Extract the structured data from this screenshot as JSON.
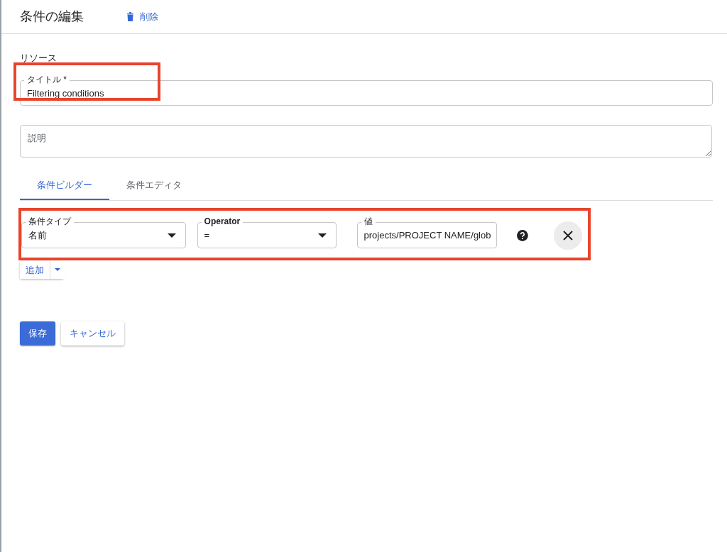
{
  "header": {
    "title": "条件の編集",
    "delete_label": "削除"
  },
  "section_label": "リソース",
  "title_field": {
    "label": "タイトル *",
    "value": "Filtering conditions"
  },
  "description_field": {
    "placeholder": "説明"
  },
  "tabs": [
    {
      "label": "条件ビルダー",
      "selected": true
    },
    {
      "label": "条件エディタ",
      "selected": false
    }
  ],
  "condition": {
    "type_field": {
      "label": "条件タイプ",
      "value": "名前"
    },
    "operator_field": {
      "label": "Operator",
      "value": "="
    },
    "value_field": {
      "label": "値",
      "value": "projects/PROJECT NAME/glob"
    }
  },
  "add_button": "追加",
  "buttons": [
    {
      "label": "保存",
      "kind": "primary"
    },
    {
      "label": "キャンセル",
      "kind": "secondary"
    }
  ]
}
